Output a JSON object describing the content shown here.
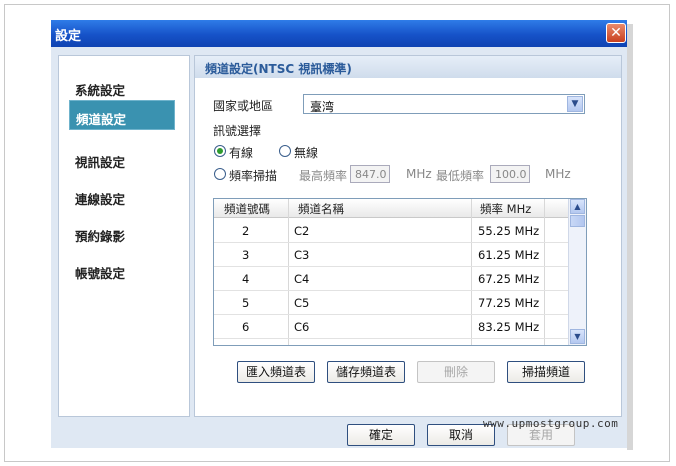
{
  "window": {
    "title": "設定",
    "close_glyph": "✕"
  },
  "sidebar": {
    "items": [
      {
        "label": "系統設定",
        "active": false
      },
      {
        "label": "頻道設定",
        "active": true
      },
      {
        "label": "視訊設定",
        "active": false
      },
      {
        "label": "連線設定",
        "active": false
      },
      {
        "label": "預約錄影",
        "active": false
      },
      {
        "label": "帳號設定",
        "active": false
      }
    ]
  },
  "panel": {
    "header": "頻道設定(NTSC 視訊標準)",
    "region": {
      "label": "國家或地區",
      "value": "臺湾"
    },
    "signal": {
      "label": "訊號選擇",
      "cable": {
        "label": "有線",
        "selected": true
      },
      "antenna": {
        "label": "無線",
        "selected": false
      },
      "scan": {
        "label": "頻率掃描",
        "selected": false
      },
      "max_freq": {
        "label": "最高頻率",
        "value": "847.0",
        "unit": "MHz"
      },
      "min_freq": {
        "label": "最低頻率",
        "value": "100.0",
        "unit": "MHz"
      }
    },
    "table": {
      "columns": [
        "頻道號碼",
        "頻道名稱",
        "頻率 MHz"
      ],
      "rows": [
        [
          "2",
          "C2",
          "55.25 MHz"
        ],
        [
          "3",
          "C3",
          "61.25 MHz"
        ],
        [
          "4",
          "C4",
          "67.25 MHz"
        ],
        [
          "5",
          "C5",
          "77.25 MHz"
        ],
        [
          "6",
          "C6",
          "83.25 MHz"
        ]
      ]
    },
    "buttons": {
      "import": "匯入頻道表",
      "save": "儲存頻道表",
      "delete": "刪除",
      "scan": "掃描頻道"
    }
  },
  "footer": {
    "ok": "確定",
    "cancel": "取消",
    "apply": "套用"
  },
  "watermark": "www.upmostgroup.com",
  "colors": {
    "titlebar": "#1652c8",
    "active_nav": "#3a92b0",
    "header_text": "#2b5b9a"
  }
}
